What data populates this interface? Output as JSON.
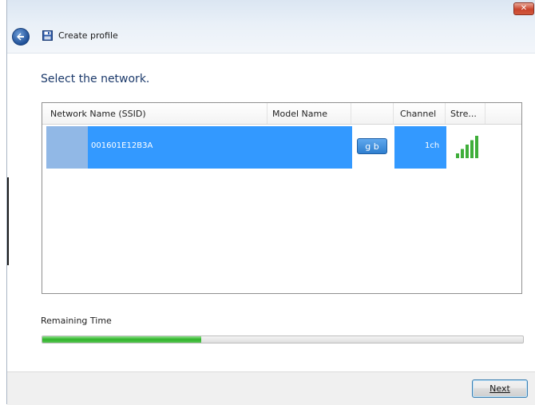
{
  "window": {
    "title": "Create profile",
    "close_label": "✕"
  },
  "main": {
    "heading": "Select the network."
  },
  "network_list": {
    "columns": [
      "Network Name (SSID)",
      "Model Name",
      "",
      "Channel",
      "Stre..."
    ],
    "rows": [
      {
        "ssid": "001601E12B3A",
        "model_name": "",
        "badge": "g b",
        "channel": "1ch",
        "signal_level": 5,
        "signal_max": 5,
        "selected": true
      }
    ]
  },
  "progress": {
    "label": "Remaining Time",
    "value_fraction": 0.33
  },
  "footer": {
    "next_label": "Next"
  },
  "colors": {
    "selection": "#3399ff",
    "selection_inactive": "#91b8e6",
    "progress": "#2fb52a",
    "signal": "#3fae3a"
  }
}
